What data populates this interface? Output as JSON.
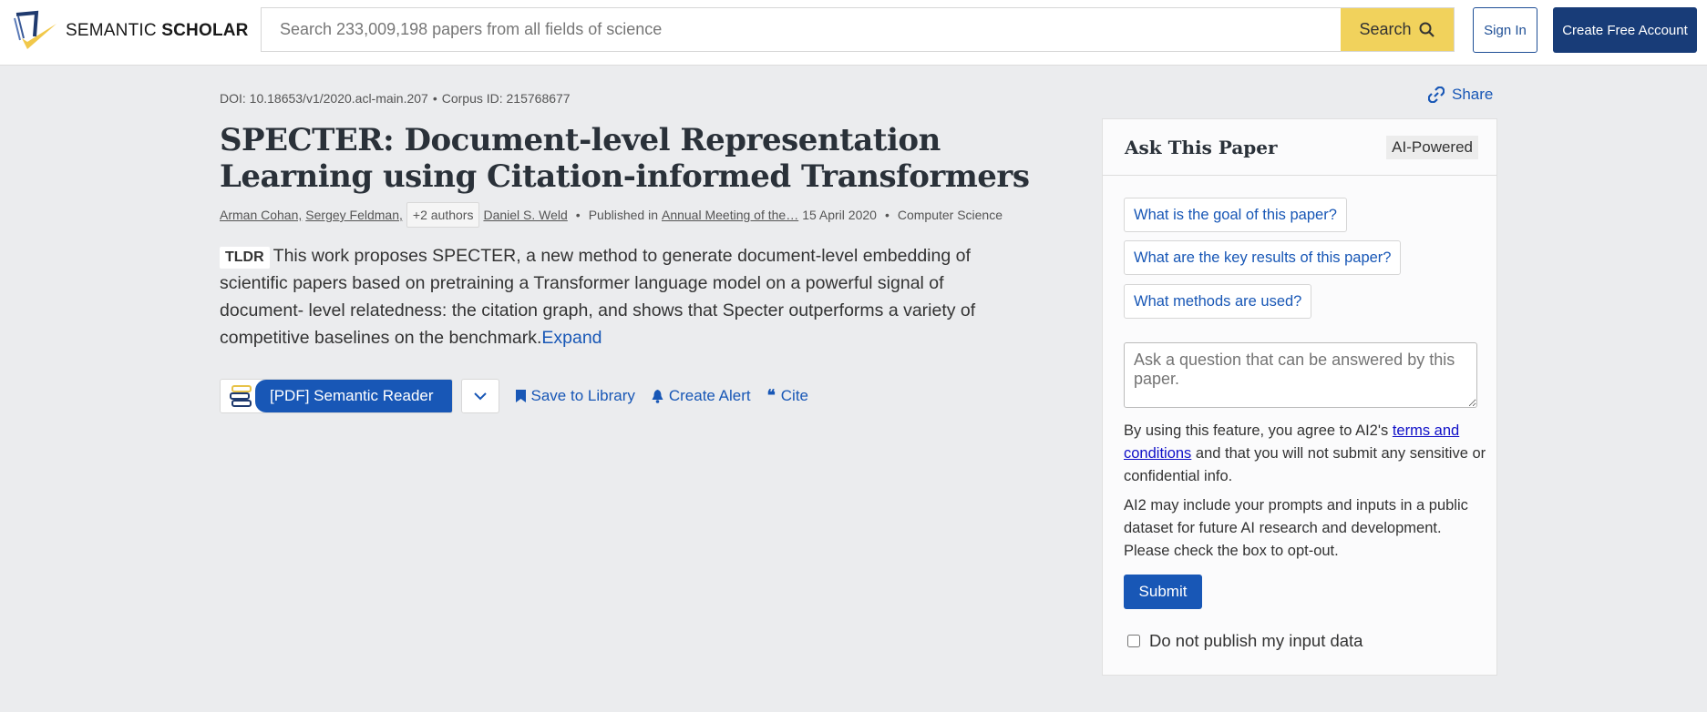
{
  "header": {
    "logo_text_1": "SEMANTIC ",
    "logo_text_2": "SCHOLAR",
    "search_placeholder": "Search 233,009,198 papers from all fields of science",
    "search_button": "Search",
    "sign_in": "Sign In",
    "create_account": "Create Free Account"
  },
  "paper": {
    "doi": "DOI: 10.18653/v1/2020.acl-main.207",
    "corpus_id": "Corpus ID: 215768677",
    "title": "SPECTER: Document-level Representation Learning using Citation-informed Transformers",
    "authors": [
      "Arman Cohan,",
      "Sergey Feldman,"
    ],
    "more_authors": "+2 authors",
    "last_author": "Daniel S. Weld",
    "published_in_label": "Published in",
    "venue": "Annual Meeting of the…",
    "date": "15 April 2020",
    "field": "Computer Science",
    "tldr_label": "TLDR",
    "tldr": "This work proposes SPECTER, a new method to generate document-level embedding of scientific papers based on pretraining a Transformer language model on a powerful signal of document- level relatedness: the citation graph, and shows that Specter outperforms a variety of competitive baselines on the benchmark.",
    "expand": "Expand"
  },
  "actions": {
    "reader": "[PDF] Semantic Reader",
    "save": "Save to Library",
    "alert": "Create Alert",
    "cite": "Cite",
    "share": "Share"
  },
  "ask": {
    "title": "Ask This Paper",
    "badge": "AI-Powered",
    "questions": [
      "What is the goal of this paper?",
      "What are the key results of this paper?",
      "What methods are used?"
    ],
    "placeholder": "Ask a question that can be answered by this paper.",
    "terms_pre": "By using this feature, you agree to AI2's ",
    "terms_link": "terms and conditions",
    "terms_post": " and that you will not submit any sensitive or confidential info.",
    "dataset_note": "AI2 may include your prompts and inputs in a public dataset for future AI research and development. Please check the box to opt-out.",
    "submit": "Submit",
    "opt_out": "Do not publish my input data"
  }
}
